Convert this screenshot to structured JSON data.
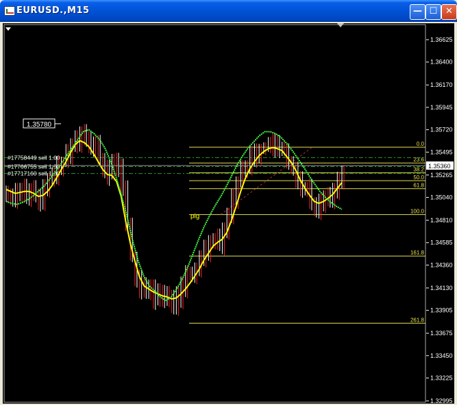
{
  "window": {
    "title": "EURUSD.,M15",
    "minimize_glyph": "—",
    "maximize_glyph": "☐",
    "close_glyph": "✕"
  },
  "colors": {
    "background": "#000000",
    "price_ticks": "#ffffff",
    "candles_up": "#ffffff",
    "candles_down": "#ff2020",
    "ma_fast": "#ffff00",
    "ma_slow": "#44ff44",
    "fib": "#e8e050",
    "order_lines": "#2a9a2a"
  },
  "chart_data": {
    "type": "line",
    "symbol": "EURUSD.",
    "timeframe": "M15",
    "ylim": [
      1.32995,
      1.3685
    ],
    "y_ticks": [
      "1.36625",
      "1.36400",
      "1.36170",
      "1.35945",
      "1.35720",
      "1.35495",
      "1.35265",
      "1.35040",
      "1.34810",
      "1.34585",
      "1.34360",
      "1.34130",
      "1.33905",
      "1.33675",
      "1.33450",
      "1.33225",
      "1.32995"
    ],
    "current_price": "1.35360",
    "price_label": "1.35780",
    "series": [
      {
        "values": [
          1.3508,
          1.3502,
          1.3511,
          1.3514,
          1.3506,
          1.3512,
          1.3505,
          1.3497,
          1.3513,
          1.352,
          1.3529,
          1.3534,
          1.354,
          1.3546,
          1.3556,
          1.3562,
          1.357,
          1.3562,
          1.3555,
          1.356,
          1.3544,
          1.3536,
          1.3528,
          1.354,
          1.3533,
          1.3516,
          1.3476,
          1.3445,
          1.3422,
          1.3412,
          1.341,
          1.3414,
          1.3403,
          1.341,
          1.34,
          1.3405,
          1.3398,
          1.3404,
          1.3413,
          1.3426,
          1.3425,
          1.3432,
          1.3445,
          1.3452,
          1.346,
          1.3464,
          1.3459,
          1.3474,
          1.3486,
          1.3504,
          1.352,
          1.353,
          1.3537,
          1.3546,
          1.3549,
          1.3552,
          1.3554,
          1.356,
          1.3556,
          1.355,
          1.3552,
          1.3541,
          1.3534,
          1.352,
          1.351,
          1.3514,
          1.3497,
          1.349,
          1.35,
          1.3507,
          1.3505,
          1.3512,
          1.352,
          1.353
        ]
      },
      {
        "values": [
          1.3512,
          1.351,
          1.3508,
          1.3509,
          1.351,
          1.351,
          1.3508,
          1.3505,
          1.3506,
          1.351,
          1.3516,
          1.3524,
          1.3532,
          1.354,
          1.3549,
          1.3557,
          1.3561,
          1.3559,
          1.3555,
          1.3548,
          1.354,
          1.3532,
          1.3527,
          1.3526,
          1.352,
          1.3505,
          1.348,
          1.3458,
          1.344,
          1.3424,
          1.3415,
          1.3412,
          1.3409,
          1.3407,
          1.3405,
          1.3404,
          1.3402,
          1.3403,
          1.3407,
          1.3412,
          1.3418,
          1.3425,
          1.3432,
          1.3441,
          1.3448,
          1.3455,
          1.3459,
          1.3462,
          1.3469,
          1.3481,
          1.3495,
          1.351,
          1.3523,
          1.3533,
          1.354,
          1.3546,
          1.355,
          1.3553,
          1.3554,
          1.3553,
          1.3551,
          1.3545,
          1.3539,
          1.3531,
          1.3521,
          1.3513,
          1.3506,
          1.35,
          1.3498,
          1.35,
          1.3503,
          1.3507,
          1.3513,
          1.3519
        ]
      },
      {
        "values": [
          1.35,
          1.3498,
          1.3497,
          1.3499,
          1.3502,
          1.3506,
          1.3511,
          1.3516,
          1.3523,
          1.353,
          1.3538,
          1.3546,
          1.3554,
          1.3562,
          1.357,
          1.3572,
          1.3568,
          1.3562,
          1.3553,
          1.354,
          1.3524,
          1.3505,
          1.3484,
          1.346,
          1.344,
          1.3425,
          1.3415,
          1.341,
          1.3404,
          1.34,
          1.3404,
          1.3412,
          1.3422,
          1.3434,
          1.3448,
          1.3462,
          1.3475,
          1.3486,
          1.3496,
          1.3505,
          1.3515,
          1.3526,
          1.3537,
          1.3546,
          1.3554,
          1.356,
          1.3566,
          1.357,
          1.357,
          1.3568,
          1.3564,
          1.3558,
          1.3551,
          1.3543,
          1.3535,
          1.3526,
          1.3518,
          1.351,
          1.3504,
          1.3499,
          1.3495,
          1.3492
        ]
      }
    ],
    "fibonacci": {
      "levels": [
        "0.0",
        "23.6",
        "38.2",
        "50.0",
        "61.8",
        "100.0",
        "161.8",
        "261.8"
      ],
      "prices": [
        1.35545,
        1.35386,
        1.35287,
        1.35208,
        1.35128,
        1.34868,
        1.34451,
        1.33776
      ]
    },
    "orders": [
      {
        "label": "#17758449 sell 1.00",
        "price": 1.3544
      },
      {
        "label": "#17766755 sell 1.00",
        "price": 1.3535
      },
      {
        "label": "#17717160 sell 1.00",
        "price": 1.3528
      }
    ],
    "annotation": "pig"
  }
}
